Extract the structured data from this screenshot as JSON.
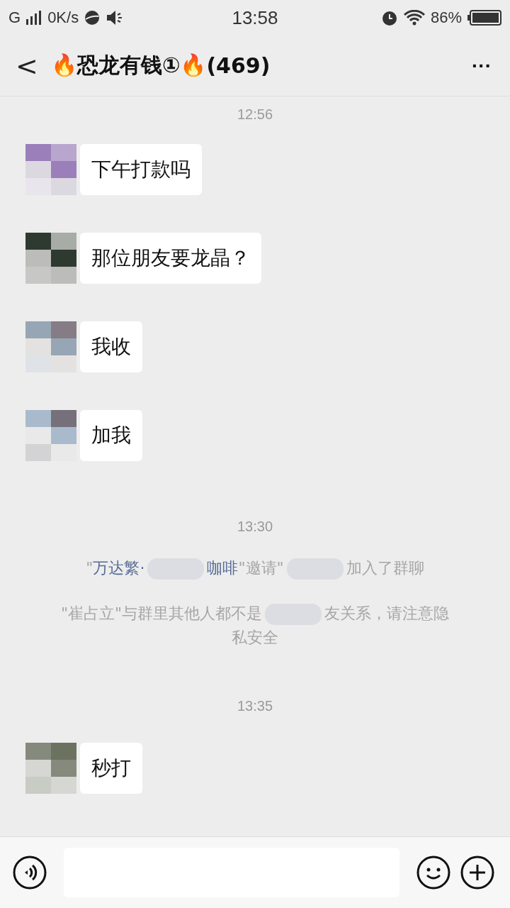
{
  "status_bar": {
    "network": "G",
    "speed": "0K/s",
    "time": "13:58",
    "battery": "86%"
  },
  "header": {
    "back": "<",
    "title": "🔥恐龙有钱①🔥",
    "count": "(469)",
    "more": "···"
  },
  "chat": [
    {
      "kind": "time",
      "text": "12:56"
    },
    {
      "kind": "message",
      "text": "下午打款吗"
    },
    {
      "kind": "message",
      "text": "那位朋友要龙晶？"
    },
    {
      "kind": "message",
      "text": "我收"
    },
    {
      "kind": "message",
      "text": "加我"
    },
    {
      "kind": "time",
      "text": "13:30"
    },
    {
      "kind": "system",
      "parts": [
        {
          "text": "\"",
          "kind": "plain"
        },
        {
          "text": "万达繁·",
          "kind": "name"
        },
        {
          "kind": "hidden"
        },
        {
          "text": "咖啡",
          "kind": "name"
        },
        {
          "text": "\"邀请\"",
          "kind": "plain"
        },
        {
          "kind": "hidden"
        },
        {
          "text": "加入了群聊",
          "kind": "plain"
        }
      ]
    },
    {
      "kind": "system",
      "parts": [
        {
          "text": "\"崔占立\"与群里其他人都不是",
          "kind": "plain"
        },
        {
          "kind": "hidden"
        },
        {
          "text": "友关系，请注意隐私安全",
          "kind": "plain"
        }
      ]
    },
    {
      "kind": "time",
      "text": "13:35"
    },
    {
      "kind": "message",
      "text": "秒打"
    }
  ]
}
